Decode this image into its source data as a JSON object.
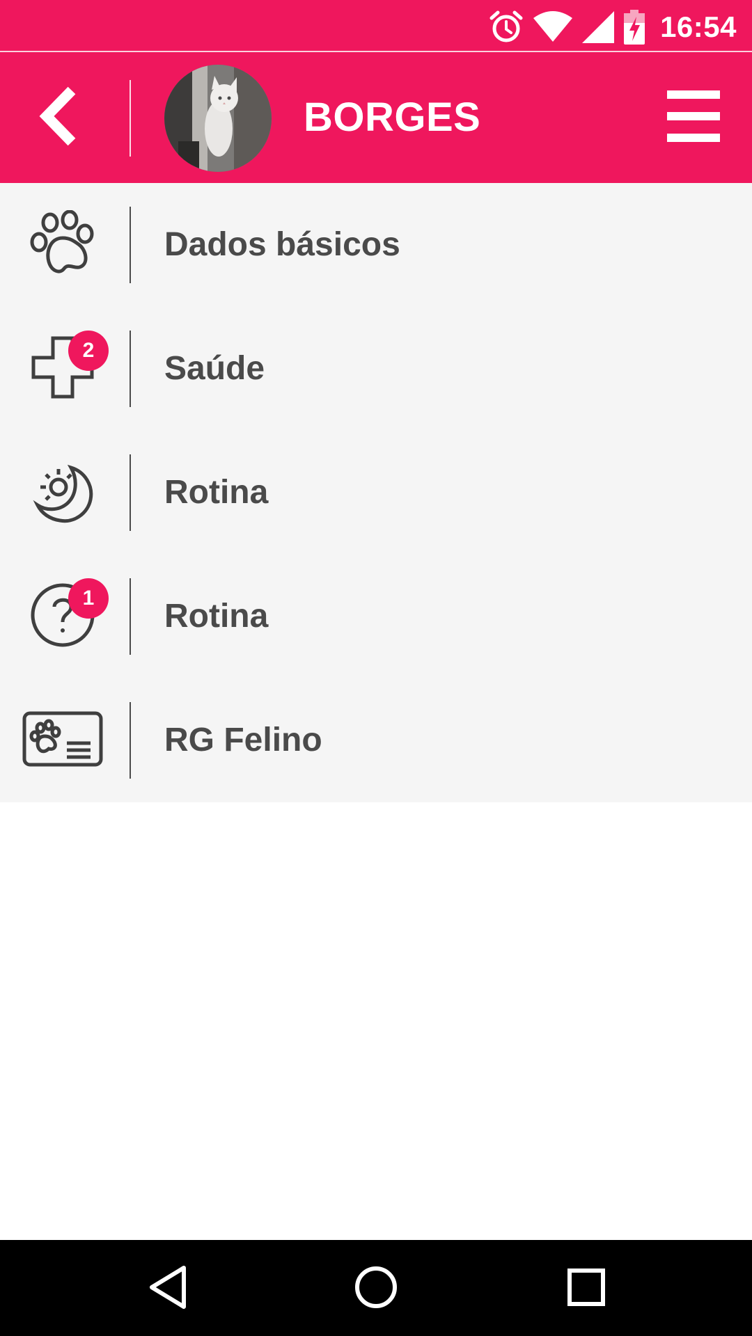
{
  "status_bar": {
    "time": "16:54",
    "icons": [
      "alarm-icon",
      "wifi-icon",
      "signal-icon",
      "battery-charging-icon"
    ]
  },
  "header": {
    "back_icon": "chevron-left-icon",
    "pet_name": "BORGES",
    "menu_icon": "hamburger-menu-icon"
  },
  "menu": {
    "items": [
      {
        "label": "Dados básicos",
        "icon": "paw-icon",
        "badge": ""
      },
      {
        "label": "Saúde",
        "icon": "health-cross-icon",
        "badge": "2"
      },
      {
        "label": "Rotina",
        "icon": "sun-moon-icon",
        "badge": ""
      },
      {
        "label": "Rotina",
        "icon": "question-icon",
        "badge": "1"
      },
      {
        "label": "RG Felino",
        "icon": "id-card-icon",
        "badge": ""
      }
    ]
  },
  "nav_bar": {
    "icons": [
      "back-triangle-icon",
      "home-circle-icon",
      "recents-square-icon"
    ]
  },
  "colors": {
    "accent": "#EF175D",
    "list_background": "#F5F5F5",
    "text": "#4A4A4A"
  }
}
